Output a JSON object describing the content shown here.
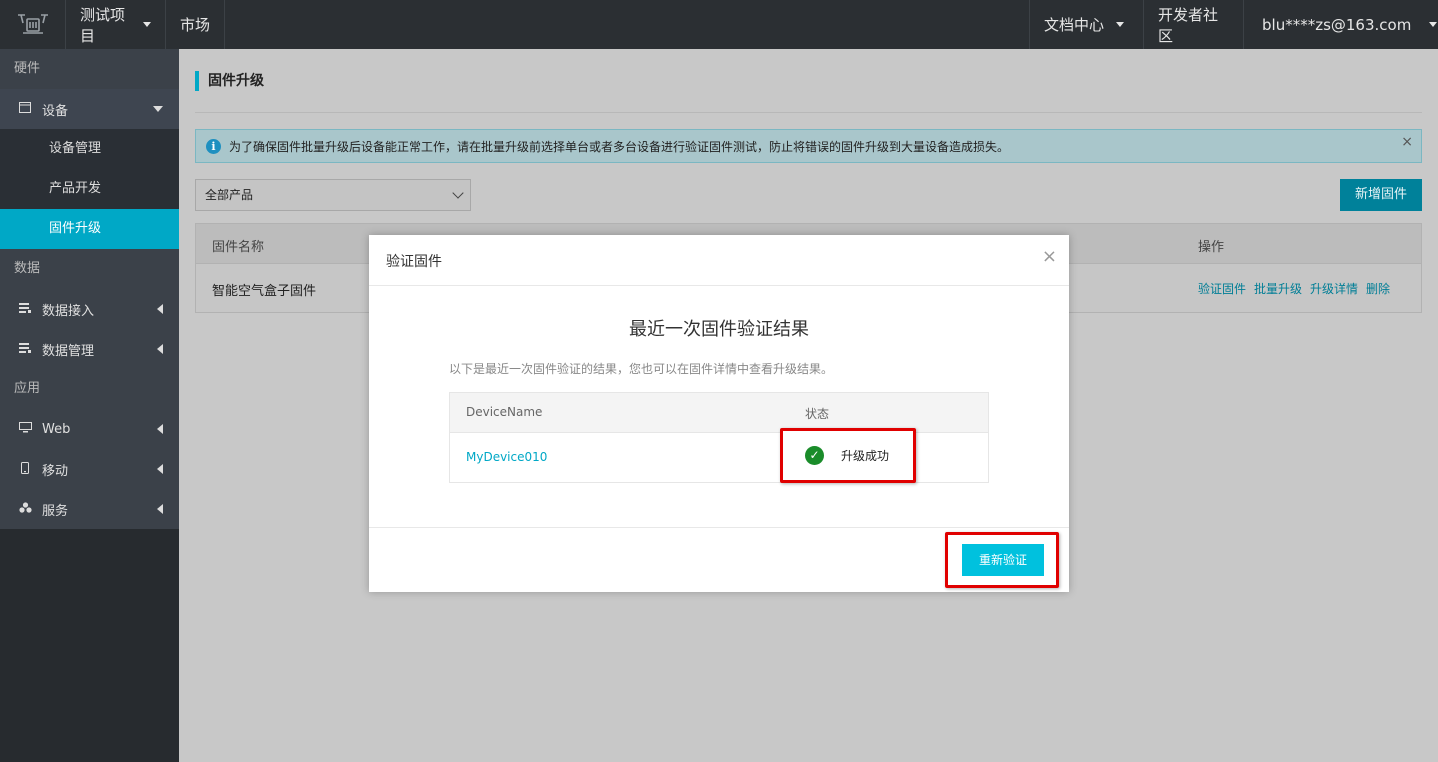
{
  "topbar": {
    "project": "测试项目",
    "market": "市场",
    "docs": "文档中心",
    "community": "开发者社区",
    "account": "blu****zs@163.com"
  },
  "sidebar": {
    "section_hardware": "硬件",
    "device": "设备",
    "device_subitems": [
      "设备管理",
      "产品开发",
      "固件升级"
    ],
    "active_subitem": "固件升级",
    "section_data": "数据",
    "data_access": "数据接入",
    "data_manage": "数据管理",
    "section_app": "应用",
    "web": "Web",
    "mobile": "移动",
    "service": "服务"
  },
  "page": {
    "title": "固件升级",
    "notice": "为了确保固件批量升级后设备能正常工作，请在批量升级前选择单台或者多台设备进行验证固件测试，防止将错误的固件升级到大量设备造成损失。",
    "notice_close": "×",
    "product_filter": "全部产品",
    "add_firmware": "新增固件",
    "table": {
      "headers": {
        "name": "固件名称",
        "ops": "操作"
      },
      "rows": [
        {
          "name": "智能空气盒子固件",
          "ops": [
            "验证固件",
            "批量升级",
            "升级详情",
            "删除"
          ]
        }
      ]
    }
  },
  "modal": {
    "title": "验证固件",
    "close": "×",
    "heading": "最近一次固件验证结果",
    "description": "以下是最近一次固件验证的结果，您也可以在固件详情中查看升级结果。",
    "table": {
      "headers": [
        "DeviceName",
        "状态"
      ],
      "rows": [
        {
          "device": "MyDevice010",
          "status": "升级成功"
        }
      ]
    },
    "reverify": "重新验证"
  },
  "colors": {
    "accent": "#00c1de",
    "highlight_border": "#e00000",
    "success": "#1a8c2a",
    "topbar": "#2b2f33",
    "sidebar_active": "#00a8c6"
  },
  "icons": {
    "logo": "iot-logo",
    "device": "window-icon",
    "data_access": "list-icon",
    "data_manage": "list-icon",
    "web": "monitor-icon",
    "mobile": "phone-icon",
    "service": "cubes-icon",
    "info": "info-icon",
    "success": "check-circle-icon"
  }
}
